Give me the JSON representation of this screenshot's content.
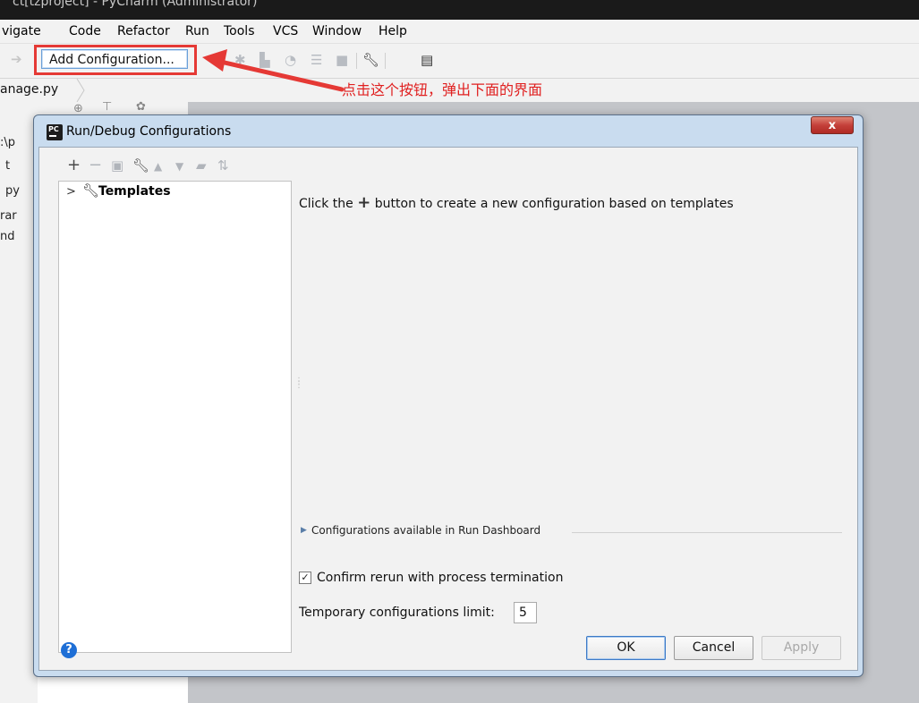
{
  "window": {
    "title": "ct[tzproject] - PyCharm (Administrator)"
  },
  "menu": {
    "items": [
      {
        "label": "vigate"
      },
      {
        "label": "Code"
      },
      {
        "label": "Refactor"
      },
      {
        "label": "Run"
      },
      {
        "label": "Tools"
      },
      {
        "label": "VCS"
      },
      {
        "label": "Window"
      },
      {
        "label": "Help"
      }
    ]
  },
  "toolbar": {
    "add_configuration": "Add Configuration..."
  },
  "navbar": {
    "breadcrumb": "anage.py"
  },
  "annotation": {
    "text": "点击这个按钮，弹出下面的界面",
    "color": "#e02020"
  },
  "project_panel": {
    "items": [
      ":\\p",
      "t",
      "py",
      "rar",
      "nd"
    ]
  },
  "dialog": {
    "title": "Run/Debug Configurations",
    "close_label": "x",
    "tree": {
      "root_label": "Templates"
    },
    "hint": {
      "prefix": "Click the",
      "plus": "+",
      "suffix": "button to create a new configuration based on templates"
    },
    "dashboard": {
      "label": "Configurations available in Run Dashboard"
    },
    "confirm_rerun": {
      "label": "Confirm rerun with process termination",
      "checked": true
    },
    "temp_limit": {
      "label": "Temporary configurations limit:",
      "value": "5"
    },
    "buttons": {
      "ok": "OK",
      "cancel": "Cancel",
      "apply": "Apply"
    },
    "help": "?"
  },
  "colors": {
    "highlight_red": "#e53935",
    "dialog_frame": "#c9dcef",
    "editor_gray": "#c3c5c9"
  }
}
